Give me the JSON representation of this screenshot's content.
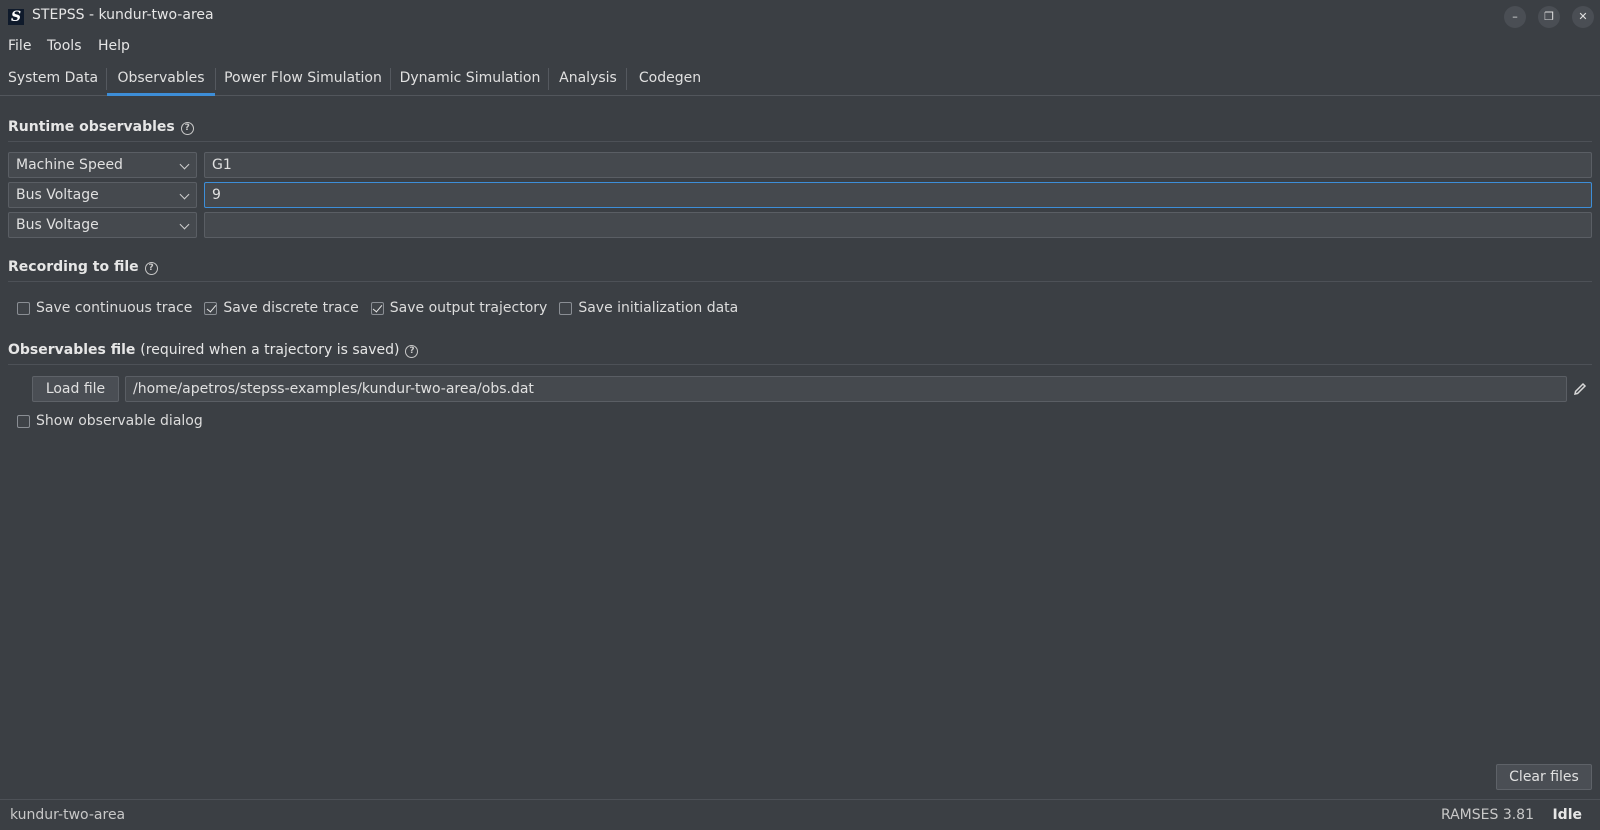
{
  "window": {
    "title": "STEPSS - kundur-two-area",
    "app_icon_letter": "S",
    "minimize_glyph": "–",
    "restore_glyph": "❐",
    "close_glyph": "✕"
  },
  "menu": [
    "File",
    "Tools",
    "Help"
  ],
  "tabs": [
    {
      "label": "System Data",
      "active": false
    },
    {
      "label": "Observables",
      "active": true
    },
    {
      "label": "Power Flow Simulation",
      "active": false
    },
    {
      "label": "Dynamic Simulation",
      "active": false
    },
    {
      "label": "Analysis",
      "active": false
    },
    {
      "label": "Codegen",
      "active": false
    }
  ],
  "runtime": {
    "title": "Runtime observables",
    "rows": [
      {
        "type": "Machine Speed",
        "value": "G1"
      },
      {
        "type": "Bus Voltage",
        "value": "9"
      },
      {
        "type": "Bus Voltage",
        "value": ""
      }
    ]
  },
  "recording": {
    "title": "Recording to file",
    "options": [
      {
        "label": "Save continuous trace",
        "checked": false
      },
      {
        "label": "Save discrete trace",
        "checked": true
      },
      {
        "label": "Save output trajectory",
        "checked": true
      },
      {
        "label": "Save initialization data",
        "checked": false
      }
    ]
  },
  "obsfile": {
    "title_bold": "Observables file",
    "title_note": "(required when a trajectory is saved)",
    "load_label": "Load file",
    "path": "/home/apetros/stepss-examples/kundur-two-area/obs.dat",
    "show_dialog_label": "Show observable dialog",
    "show_dialog_checked": false
  },
  "clear_files_label": "Clear files",
  "status": {
    "project": "kundur-two-area",
    "version": "RAMSES 3.81",
    "state": "Idle"
  },
  "help_glyph": "?",
  "colors": {
    "background": "#3b3f44",
    "accent": "#3d8ed8"
  }
}
